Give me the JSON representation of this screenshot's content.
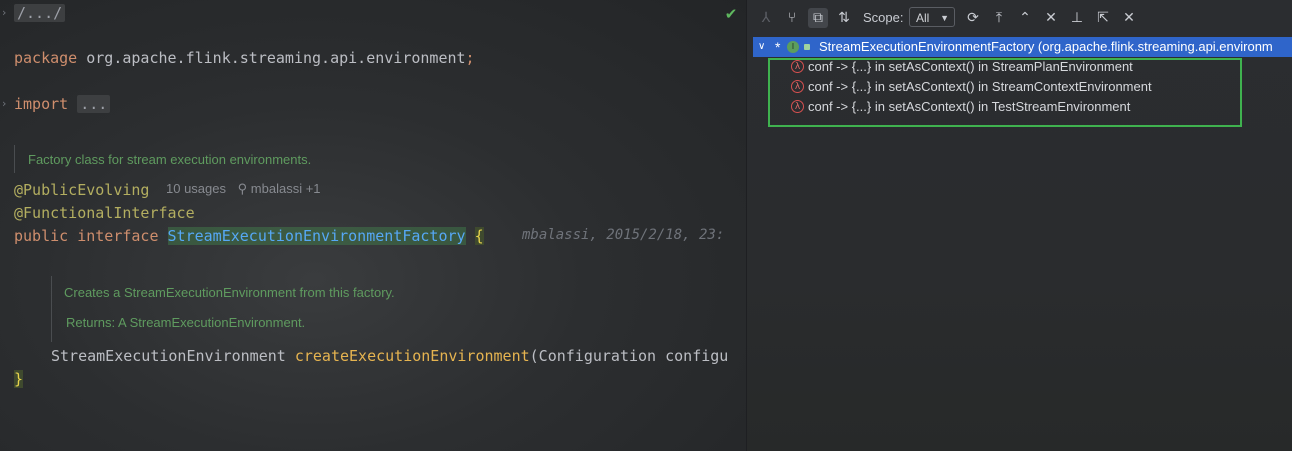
{
  "editor": {
    "lines": {
      "fold_path": "/.../",
      "package_kw": "package",
      "package_name": "org.apache.flink.streaming.api.environment",
      "semicolon": ";",
      "import_kw": "import",
      "import_fold": "...",
      "doc1": "Factory class for stream execution environments.",
      "ann_public_evolving": "@PublicEvolving",
      "usages": "10 usages",
      "author": "mbalassi +1",
      "ann_functional": "@FunctionalInterface",
      "public_kw": "public",
      "interface_kw": "interface",
      "class_name": "StreamExecutionEnvironmentFactory",
      "open_brace": "{",
      "blame": "mbalassi, 2015/2/18, 23:",
      "doc2_line1": "Creates a StreamExecutionEnvironment from this factory.",
      "doc2_line2": "Returns: A StreamExecutionEnvironment.",
      "method_return": "StreamExecutionEnvironment",
      "method_name": "createExecutionEnvironment",
      "method_args": "(Configuration configu",
      "close_brace": "}"
    }
  },
  "panel": {
    "toolbar": {
      "scope_label": "Scope:",
      "scope_value": "All"
    },
    "tree": {
      "root_label": "StreamExecutionEnvironmentFactory (org.apache.flink.streaming.api.environm",
      "root_star": "*",
      "items": [
        {
          "label": "conf -> {...} in setAsContext() in StreamPlanEnvironment"
        },
        {
          "label": "conf -> {...} in setAsContext() in StreamContextEnvironment"
        },
        {
          "label": "conf -> {...} in setAsContext() in TestStreamEnvironment"
        }
      ]
    }
  },
  "colors": {
    "selection": "#2f65ca",
    "highlight_box": "#3fb24f",
    "keyword": "#cf8e6d",
    "annotation": "#b3ae60",
    "doc_comment": "#5f9b5f"
  }
}
